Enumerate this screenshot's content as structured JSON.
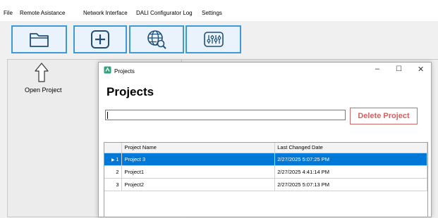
{
  "menu": {
    "items": [
      "File",
      "Remote Asistance",
      "Network Interface",
      "DALI Configurator Log",
      "Settings"
    ]
  },
  "toolbar": {
    "buttons": [
      {
        "name": "open-project-button",
        "icon": "folder-icon"
      },
      {
        "name": "new-project-button",
        "icon": "plus-icon"
      },
      {
        "name": "network-search-button",
        "icon": "globe-search-icon"
      },
      {
        "name": "settings-sliders-button",
        "icon": "sliders-icon"
      }
    ],
    "accent_color": "#3a9bd8"
  },
  "left_panel": {
    "hint_label": "Open Project"
  },
  "dialog": {
    "window_title": "Projects",
    "heading": "Projects",
    "search_value": "",
    "delete_label": "Delete Project",
    "window_controls": {
      "minimize": "–",
      "maximize": "☐",
      "close": "✕"
    },
    "grid": {
      "columns": [
        "Project Name",
        "Last Changed Date"
      ],
      "rows": [
        {
          "index": "1",
          "name": "Project 3",
          "date": "2/27/2025 5:07:25 PM",
          "selected": true
        },
        {
          "index": "2",
          "name": "Project1",
          "date": "2/27/2025 4:41:14 PM",
          "selected": false
        },
        {
          "index": "3",
          "name": "Project2",
          "date": "2/27/2025 5:07:13 PM",
          "selected": false
        }
      ],
      "selection_color": "#0078d7"
    }
  }
}
